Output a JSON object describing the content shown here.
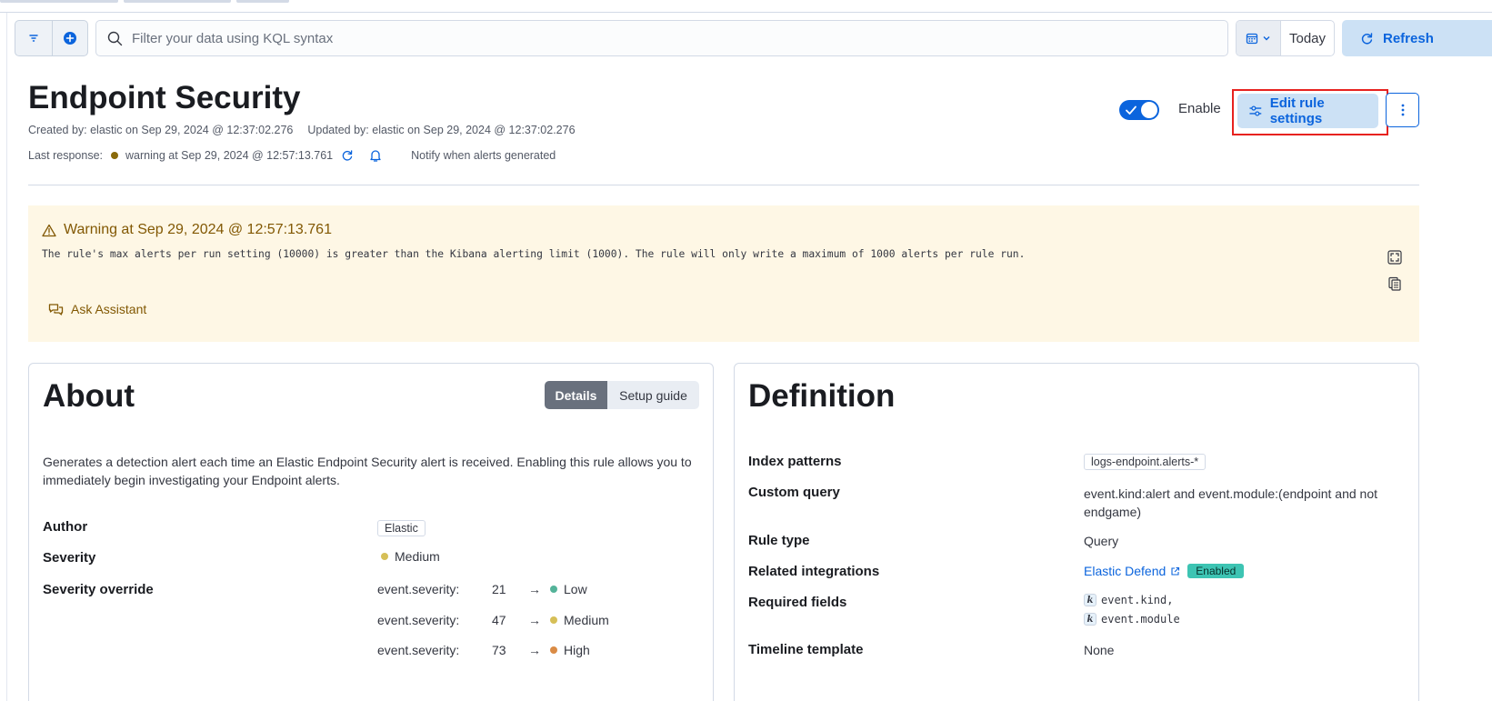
{
  "query_bar": {
    "search_placeholder": "Filter your data using KQL syntax",
    "date_label": "Today",
    "refresh_label": "Refresh"
  },
  "header": {
    "title": "Endpoint Security",
    "created_by": "Created by: elastic on Sep 29, 2024 @ 12:37:02.276",
    "updated_by": "Updated by: elastic on Sep 29, 2024 @ 12:37:02.276",
    "last_response_label": "Last response:",
    "last_response_value": "warning at Sep 29, 2024 @ 12:57:13.761",
    "notify_text": "Notify when alerts generated",
    "enable_label": "Enable",
    "edit_button_label": "Edit rule settings",
    "enabled": true
  },
  "warning": {
    "title": "Warning at Sep 29, 2024 @ 12:57:13.761",
    "message": "The rule's max alerts per run setting (10000) is greater than the Kibana alerting limit (1000). The rule will only write a maximum of 1000 alerts per rule run.",
    "ask_label": "Ask Assistant"
  },
  "about": {
    "title": "About",
    "tabs": [
      {
        "label": "Details",
        "active": true
      },
      {
        "label": "Setup guide",
        "active": false
      }
    ],
    "description": "Generates a detection alert each time an Elastic Endpoint Security alert is received. Enabling this rule allows you to immediately begin investigating your Endpoint alerts.",
    "author_label": "Author",
    "author_value": "Elastic",
    "severity_label": "Severity",
    "severity_value": "Medium",
    "severity_override_label": "Severity override",
    "overrides": [
      {
        "field": "event.severity:",
        "value": "21",
        "arrow": "→",
        "level": "Low",
        "color": "#54b399"
      },
      {
        "field": "event.severity:",
        "value": "47",
        "arrow": "→",
        "level": "Medium",
        "color": "#d6bf57"
      },
      {
        "field": "event.severity:",
        "value": "73",
        "arrow": "→",
        "level": "High",
        "color": "#da8b45"
      }
    ]
  },
  "definition": {
    "title": "Definition",
    "index_patterns_label": "Index patterns",
    "index_patterns_value": "logs-endpoint.alerts-*",
    "custom_query_label": "Custom query",
    "custom_query_value": "event.kind:alert and event.module:(endpoint and not endgame)",
    "rule_type_label": "Rule type",
    "rule_type_value": "Query",
    "related_integrations_label": "Related integrations",
    "integration_name": "Elastic Defend",
    "integration_status": "Enabled",
    "required_fields_label": "Required fields",
    "required_fields": [
      "event.kind,",
      "event.module"
    ],
    "timeline_template_label": "Timeline template",
    "timeline_template_value": "None"
  },
  "colors": {
    "accent": "#0b64dd",
    "warning_bg": "#fef7e5",
    "warning_text": "#825803",
    "warning_dot": "#8a6a0a",
    "medium": "#d6bf57",
    "highlight_frame": "#e7221f"
  }
}
